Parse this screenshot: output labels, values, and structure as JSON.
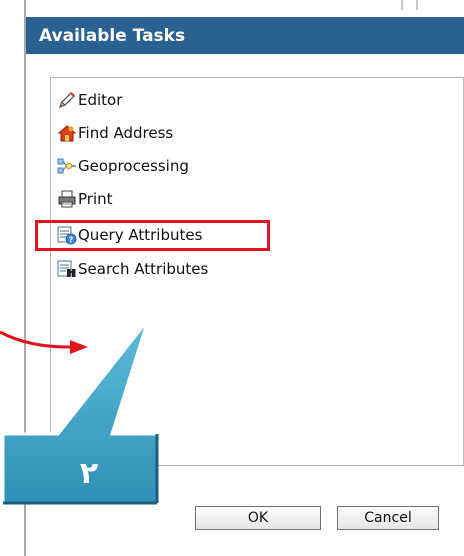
{
  "dialog": {
    "title": "Available Tasks",
    "tasks": [
      {
        "label": "Editor",
        "icon": "pencil-icon"
      },
      {
        "label": "Find Address",
        "icon": "find-address-icon"
      },
      {
        "label": "Geoprocessing",
        "icon": "geoprocessing-icon"
      },
      {
        "label": "Print",
        "icon": "printer-icon"
      },
      {
        "label": "Query Attributes",
        "icon": "query-attributes-icon"
      },
      {
        "label": "Search Attributes",
        "icon": "search-attributes-icon"
      }
    ],
    "ok_label": "OK",
    "cancel_label": "Cancel"
  },
  "annotation": {
    "callout_number": "٢",
    "highlight_color": "#e0141e",
    "arrow_color": "#e0141e",
    "callout_color": "#3a9fc4"
  },
  "colors": {
    "title_bar": "#2b6191",
    "title_text": "#ffffff"
  }
}
